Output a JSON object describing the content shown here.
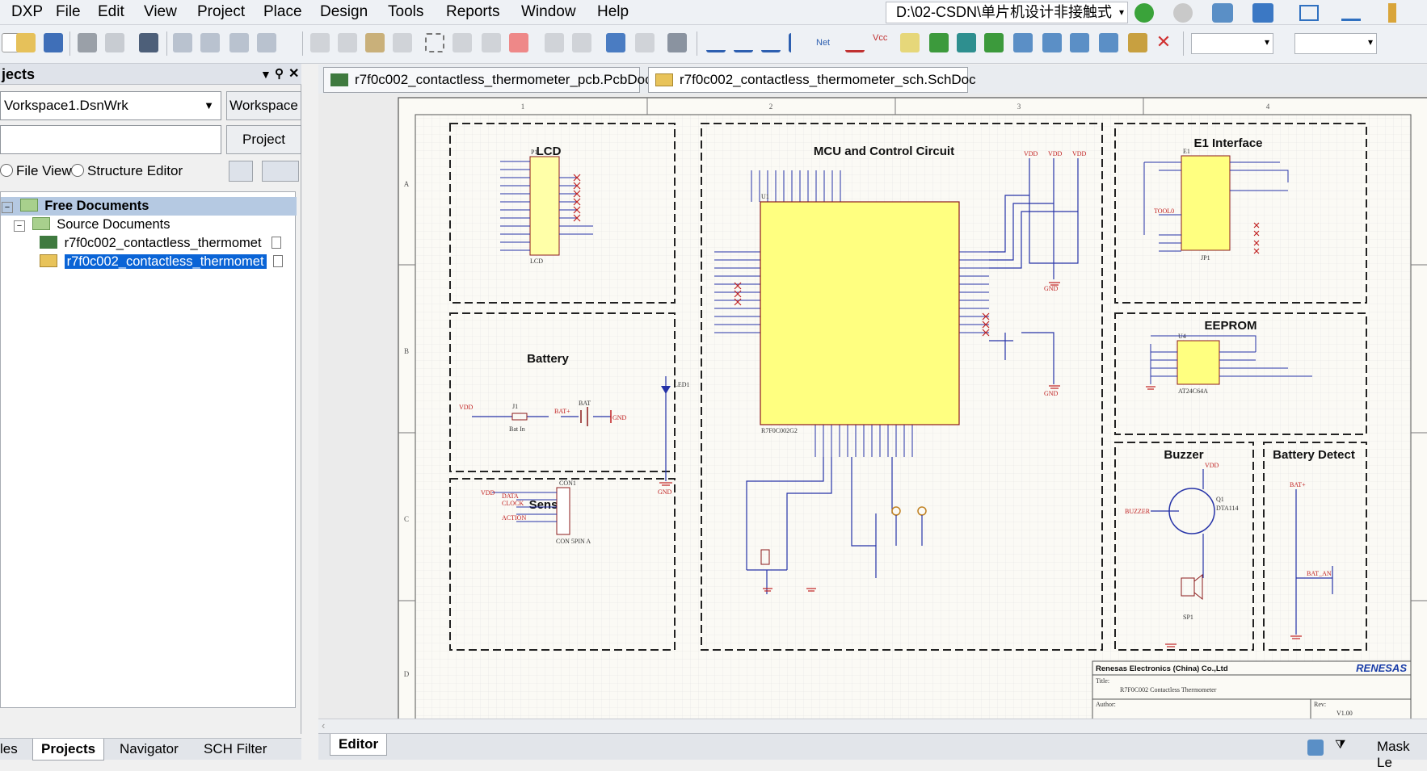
{
  "menu": {
    "items": [
      "DXP",
      "File",
      "Edit",
      "View",
      "Project",
      "Place",
      "Design",
      "Tools",
      "Reports",
      "Window",
      "Help"
    ],
    "path": "D:\\02-CSDN\\单片机设计非接触式"
  },
  "panel": {
    "title": "jects",
    "workspace_value": "Vorkspace1.DsnWrk",
    "workspace_button": "Workspace",
    "project_value": "",
    "project_button": "Project",
    "radio_file_view": "File View",
    "radio_structure": "Structure Editor",
    "tree": {
      "root": "Free Documents",
      "folder": "Source Documents",
      "doc1": "r7f0c002_contactless_thermomet",
      "doc2": "r7f0c002_contactless_thermomet"
    }
  },
  "bottom_tabs": [
    "les",
    "Projects",
    "Navigator",
    "SCH Filter"
  ],
  "doc_tabs": [
    "r7f0c002_contactless_thermometer_pcb.PcbDoc",
    "r7f0c002_contactless_thermometer_sch.SchDoc"
  ],
  "schematic": {
    "col_labels": [
      "1",
      "2",
      "3",
      "4"
    ],
    "row_labels": [
      "A",
      "B",
      "C",
      "D"
    ],
    "blocks": {
      "lcd": "LCD",
      "mcu": "MCU and Control Circuit",
      "e1": "E1 Interface",
      "battery": "Battery",
      "eeprom": "EEPROM",
      "sensor": "Sensor",
      "buzzer": "Buzzer",
      "battery_detect": "Battery Detect"
    },
    "parts": {
      "lcd_ref": "P1",
      "lcd_name": "LCD",
      "mcu_ref": "U1",
      "mcu_part": "R7F0C002G2",
      "e1_ref": "E1",
      "e1_jp": "JP1",
      "eeprom_ref": "U4",
      "eeprom_part": "AT24C64A",
      "sensor_ref": "CON1",
      "sensor_part": "CON 5PIN A",
      "bat_ref": "J1",
      "bat_sw": "Bat In",
      "bat_label": "BAT",
      "led": "LED1",
      "q1": "Q1",
      "q1_part": "DTA114",
      "sp1": "SP1"
    },
    "nets": {
      "vdd": "VDD",
      "gnd": "GND",
      "batp": "BAT+",
      "bat_an": "BAT_AN",
      "data": "DATA",
      "clock": "CLOCK",
      "action": "ACTION",
      "buzzer": "BUZZER",
      "tool0": "TOOL0"
    },
    "title_block": {
      "company": "Renesas Electronics (China) Co.,Ltd",
      "logo": "RENESAS",
      "title_label": "Title:",
      "title": "R7F0C002 Contactless Thermometer",
      "author_label": "Author:",
      "rev_label": "Rev:",
      "rev": "V1.00"
    }
  },
  "status": {
    "editor_tab": "Editor",
    "mask": "Mask Le"
  }
}
